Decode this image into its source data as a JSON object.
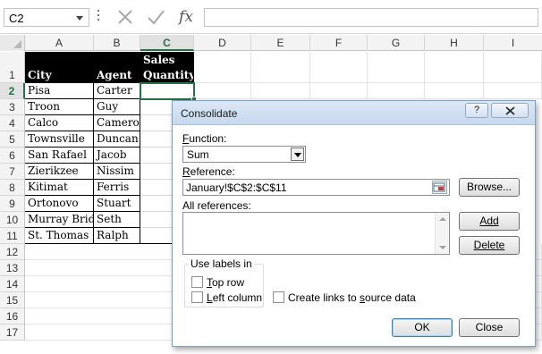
{
  "formula_bar": {
    "name_box": "C2",
    "fx": "fx",
    "formula": ""
  },
  "columns": [
    "A",
    "B",
    "C",
    "D",
    "E",
    "F",
    "G",
    "H",
    "I"
  ],
  "rows": [
    "1",
    "2",
    "3",
    "4",
    "5",
    "6",
    "7",
    "8",
    "9",
    "10",
    "11",
    "12",
    "13",
    "14",
    "15",
    "16",
    "17"
  ],
  "sheet": {
    "header": {
      "city": "City",
      "agent": "Agent",
      "sales_line1": "Sales",
      "sales_line2": "Quantity"
    },
    "data": [
      {
        "city": "Pisa",
        "agent": "Carter"
      },
      {
        "city": "Troon",
        "agent": "Guy"
      },
      {
        "city": "Calco",
        "agent": "Cameron"
      },
      {
        "city": "Townsville",
        "agent": "Duncan"
      },
      {
        "city": "San Rafael",
        "agent": "Jacob"
      },
      {
        "city": "Zierikzee",
        "agent": "Nissim"
      },
      {
        "city": "Kitimat",
        "agent": "Ferris"
      },
      {
        "city": "Ortonovo",
        "agent": "Stuart"
      },
      {
        "city": "Murray Bridge",
        "agent": "Seth"
      },
      {
        "city": "St. Thomas",
        "agent": "Ralph"
      }
    ]
  },
  "dialog": {
    "title": "Consolidate",
    "help_label": "?",
    "function_label_key": "F",
    "function_label_rest": "unction:",
    "function_value": "Sum",
    "reference_label_key": "R",
    "reference_label_rest": "eference:",
    "reference_value": "January!$C$2:$C$11",
    "browse_label": "Browse...",
    "all_references_label": "All references:",
    "add_label": "Add",
    "delete_label": "Delete",
    "use_labels_title": "Use labels in",
    "top_row_key": "T",
    "top_row_rest": "op row",
    "left_column_key": "L",
    "left_column_rest": "eft column",
    "create_links_pre": "Create links to ",
    "create_links_key": "s",
    "create_links_post": "ource data",
    "ok_label": "OK",
    "close_label": "Close"
  },
  "colors": {
    "excel_green": "#217346",
    "header_black": "#000000",
    "dialog_title": "#c7d9ee"
  }
}
